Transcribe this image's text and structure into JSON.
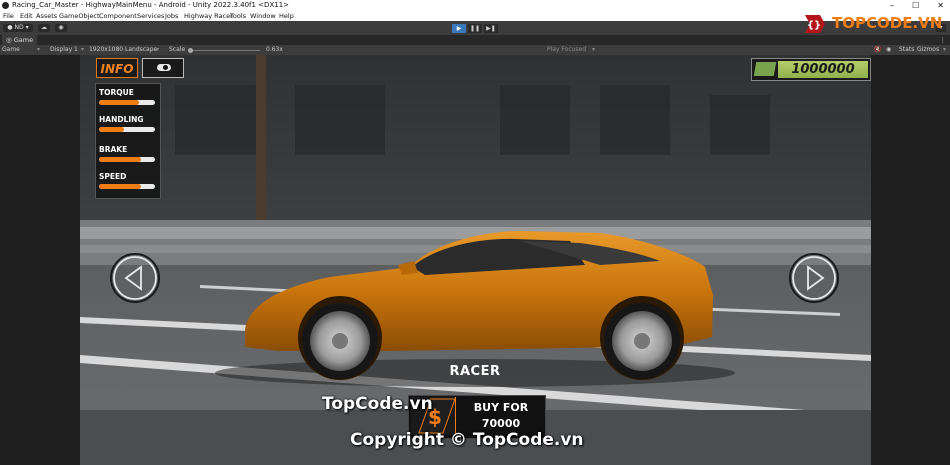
{
  "window": {
    "title": "Racing_Car_Master - HighwayMainMenu - Android - Unity 2022.3.40f1 <DX11>",
    "controls": [
      "–",
      "☐",
      "✕"
    ]
  },
  "menu": [
    "File",
    "Edit",
    "Assets",
    "GameObject",
    "Component",
    "Services",
    "Jobs",
    "Highway Racer",
    "Tools",
    "Window",
    "Help"
  ],
  "toolbar": {
    "account": "● ND ▾",
    "play_icon": "▶",
    "pause_icon": "❚❚",
    "step_icon": "▶❚"
  },
  "game_tab": {
    "label": "◎ Game",
    "view_select": "Game",
    "display": "Display 1",
    "resolution": "1920x1080 Landscape",
    "scale_label": "Scale",
    "scale_value": "0.63x",
    "play_mode": "Play Focused",
    "stats": "Stats",
    "gizmos": "Gizmos"
  },
  "game": {
    "info_label": "INFO",
    "cash": "1000000",
    "stats": [
      {
        "label": "TORQUE",
        "value": 0.72
      },
      {
        "label": "HANDLING",
        "value": 0.45
      },
      {
        "label": "BRAKE",
        "value": 0.75
      },
      {
        "label": "SPEED",
        "value": 0.75
      }
    ],
    "car_name": "RACER",
    "buy_line1": "BUY FOR",
    "buy_line2": "70000"
  },
  "watermark": {
    "center": "TopCode.vn",
    "copyright": "Copyright © TopCode.vn",
    "logo": "TOPCODE.VN"
  },
  "colors": {
    "accent": "#f07d14",
    "cash_green": "#9dbc58",
    "car": "#d6820f"
  }
}
